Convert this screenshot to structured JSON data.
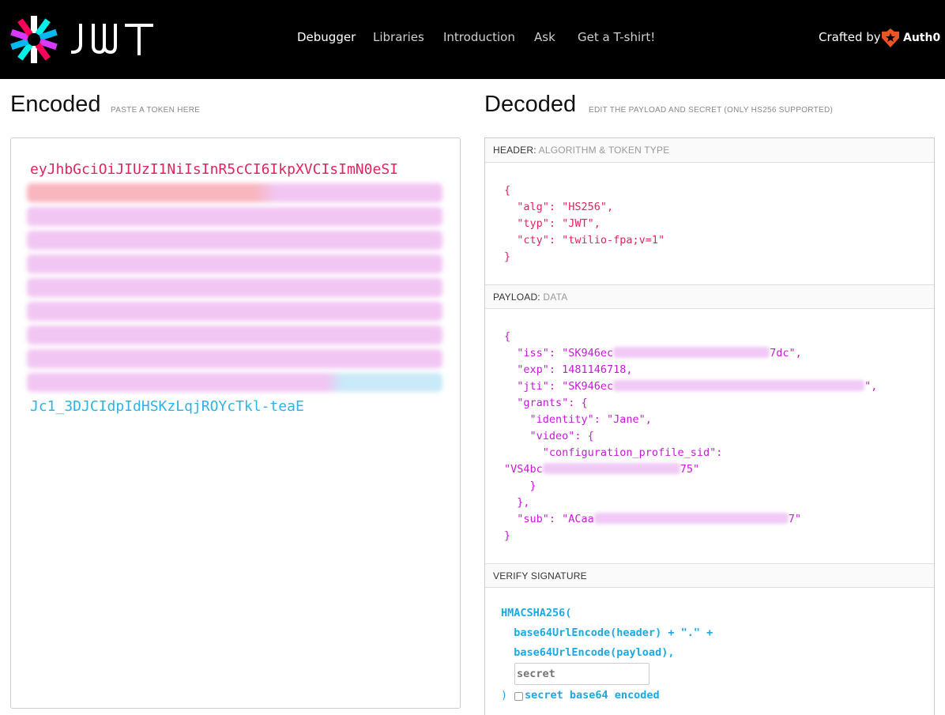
{
  "nav": {
    "items": [
      {
        "label": "Debugger",
        "active": true
      },
      {
        "label": "Libraries",
        "active": false
      },
      {
        "label": "Introduction",
        "active": false
      },
      {
        "label": "Ask",
        "active": false
      },
      {
        "label": "Get a T-shirt!",
        "active": false
      }
    ],
    "crafted_by": "Crafted by",
    "brand": "Auth0",
    "logo_text": "JWT"
  },
  "encoded": {
    "title": "Encoded",
    "subtitle": "PASTE A TOKEN HERE",
    "header_line": "eyJhbGciOiJIUzI1NiIsInR5cCI6IkpXVCIsImN0eSI",
    "signature_line": "Jc1_3DJCIdpIdHSKzLqjROYcTkl-teaE"
  },
  "decoded": {
    "title": "Decoded",
    "subtitle": "EDIT THE PAYLOAD AND SECRET (ONLY HS256 SUPPORTED)",
    "header_section": {
      "label": "HEADER:",
      "sublabel": "ALGORITHM & TOKEN TYPE"
    },
    "payload_section": {
      "label": "PAYLOAD:",
      "sublabel": "DATA"
    },
    "verify_section": {
      "label": "VERIFY SIGNATURE"
    },
    "header_json": {
      "open": "{",
      "alg": "  \"alg\": \"HS256\",",
      "typ": "  \"typ\": \"JWT\",",
      "cty": "  \"cty\": \"twilio-fpa;v=1\"",
      "close": "}"
    },
    "payload_json": {
      "open": "{",
      "iss_pre": "  \"iss\": \"SK946ec",
      "iss_post": "7dc\",",
      "exp": "  \"exp\": 1481146718,",
      "jti_pre": "  \"jti\": \"SK946ec",
      "jti_post": "\",",
      "grants_open": "  \"grants\": {",
      "identity": "    \"identity\": \"Jane\",",
      "video_open": "    \"video\": {",
      "config_key": "      \"configuration_profile_sid\":",
      "config_pre": "\"VS4bc",
      "config_post": "75\"",
      "video_close": "    }",
      "grants_close": "  },",
      "sub_pre": "  \"sub\": \"ACaa",
      "sub_post": "7\"",
      "close": "}"
    },
    "verify": {
      "line1": "HMACSHA256(",
      "line2": "  base64UrlEncode(header) + \".\" +",
      "line3": "  base64UrlEncode(payload),",
      "secret_placeholder": "secret",
      "close": ")",
      "base64_label": "secret base64 encoded"
    }
  }
}
